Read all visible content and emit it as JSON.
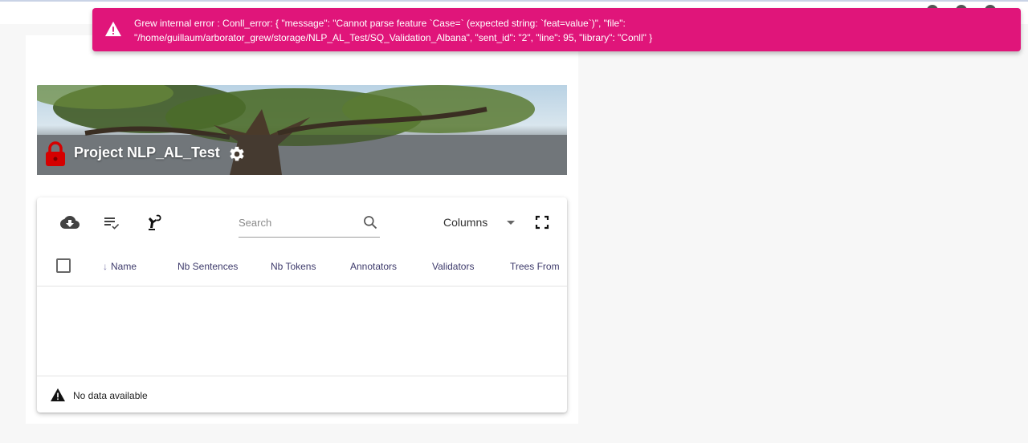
{
  "toast": {
    "line1": "Grew internal error : Conll_error: { \"message\": \"Cannot parse feature `Case=` (expected string: `feat=value`)\", \"file\":",
    "line2": "\"/home/guillaum/arborator_grew/storage/NLP_AL_Test/SQ_Validation_Albana\", \"sent_id\": \"2\", \"line\": 95, \"library\": \"Conll\" }",
    "icon": "warning-icon",
    "color": "#e0157a"
  },
  "project": {
    "title": "Project NLP_AL_Test",
    "lock_color": "#d50000"
  },
  "table": {
    "search_placeholder": "Search",
    "columns_label": "Columns",
    "headers": [
      "Name",
      "Nb Sentences",
      "Nb Tokens",
      "Annotators",
      "Validators",
      "Trees From"
    ],
    "empty_message": "No data available"
  }
}
